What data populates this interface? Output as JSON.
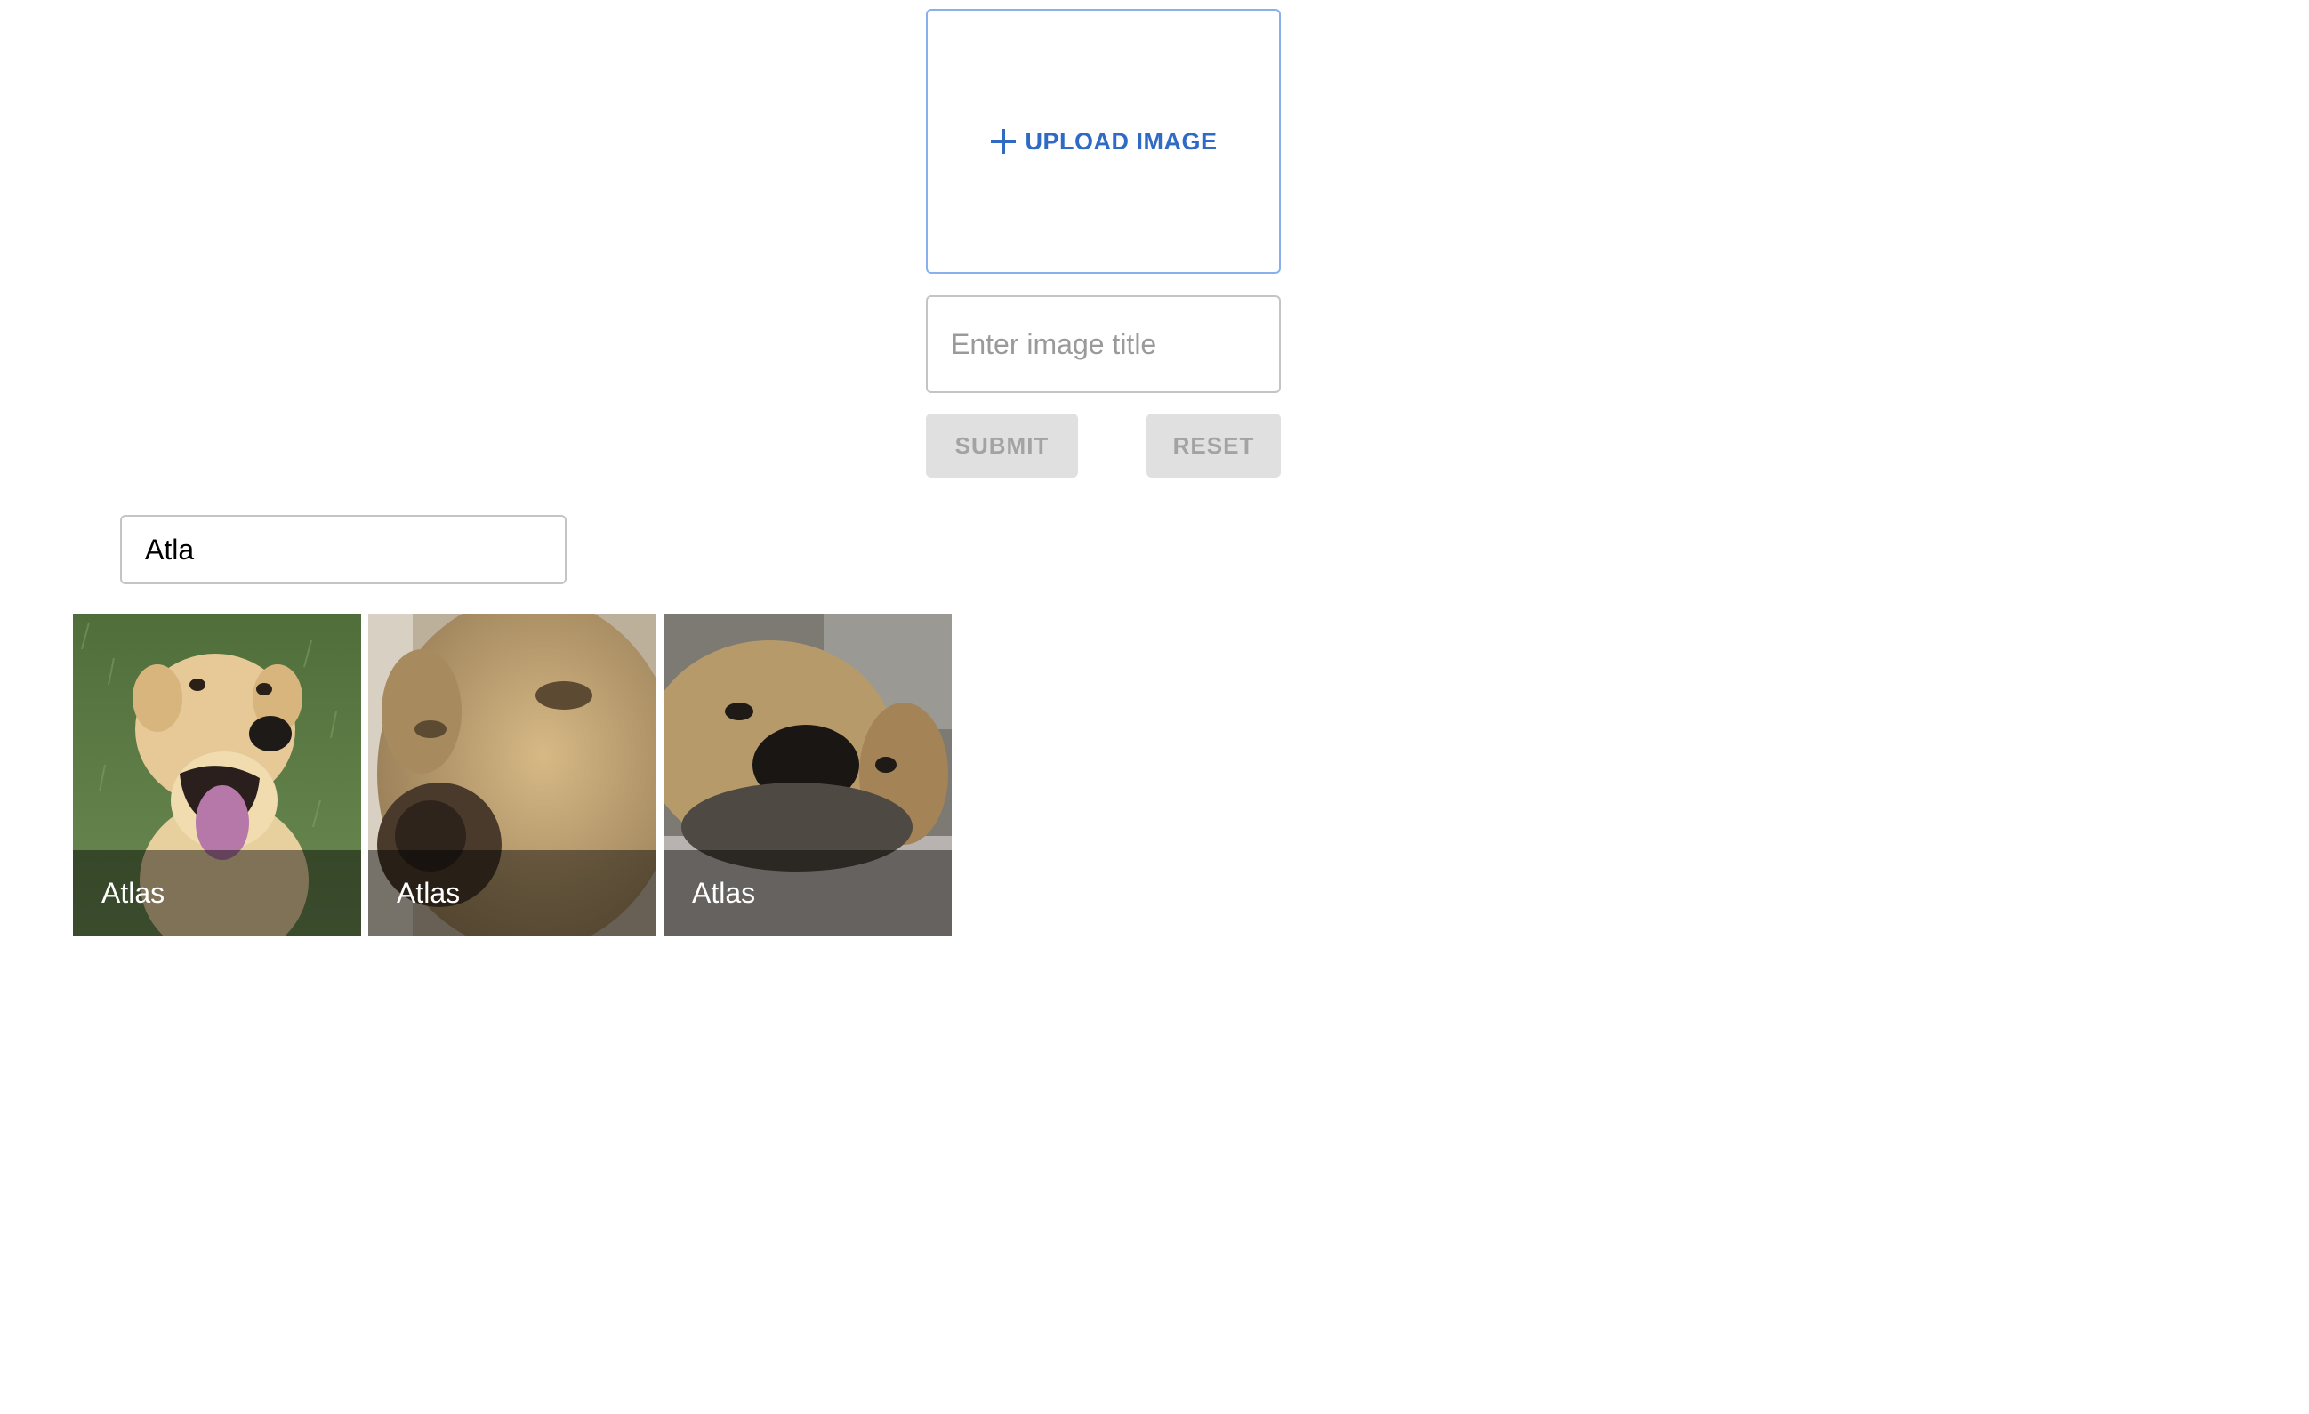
{
  "upload": {
    "label": "UPLOAD IMAGE",
    "icon": "plus-icon",
    "accent_color": "#2f6bc4"
  },
  "title_field": {
    "placeholder": "Enter image title",
    "value": ""
  },
  "actions": {
    "submit_label": "SUBMIT",
    "reset_label": "RESET"
  },
  "search": {
    "value": "Atla"
  },
  "gallery": {
    "items": [
      {
        "caption": "Atlas"
      },
      {
        "caption": "Atlas"
      },
      {
        "caption": "Atlas"
      }
    ]
  }
}
